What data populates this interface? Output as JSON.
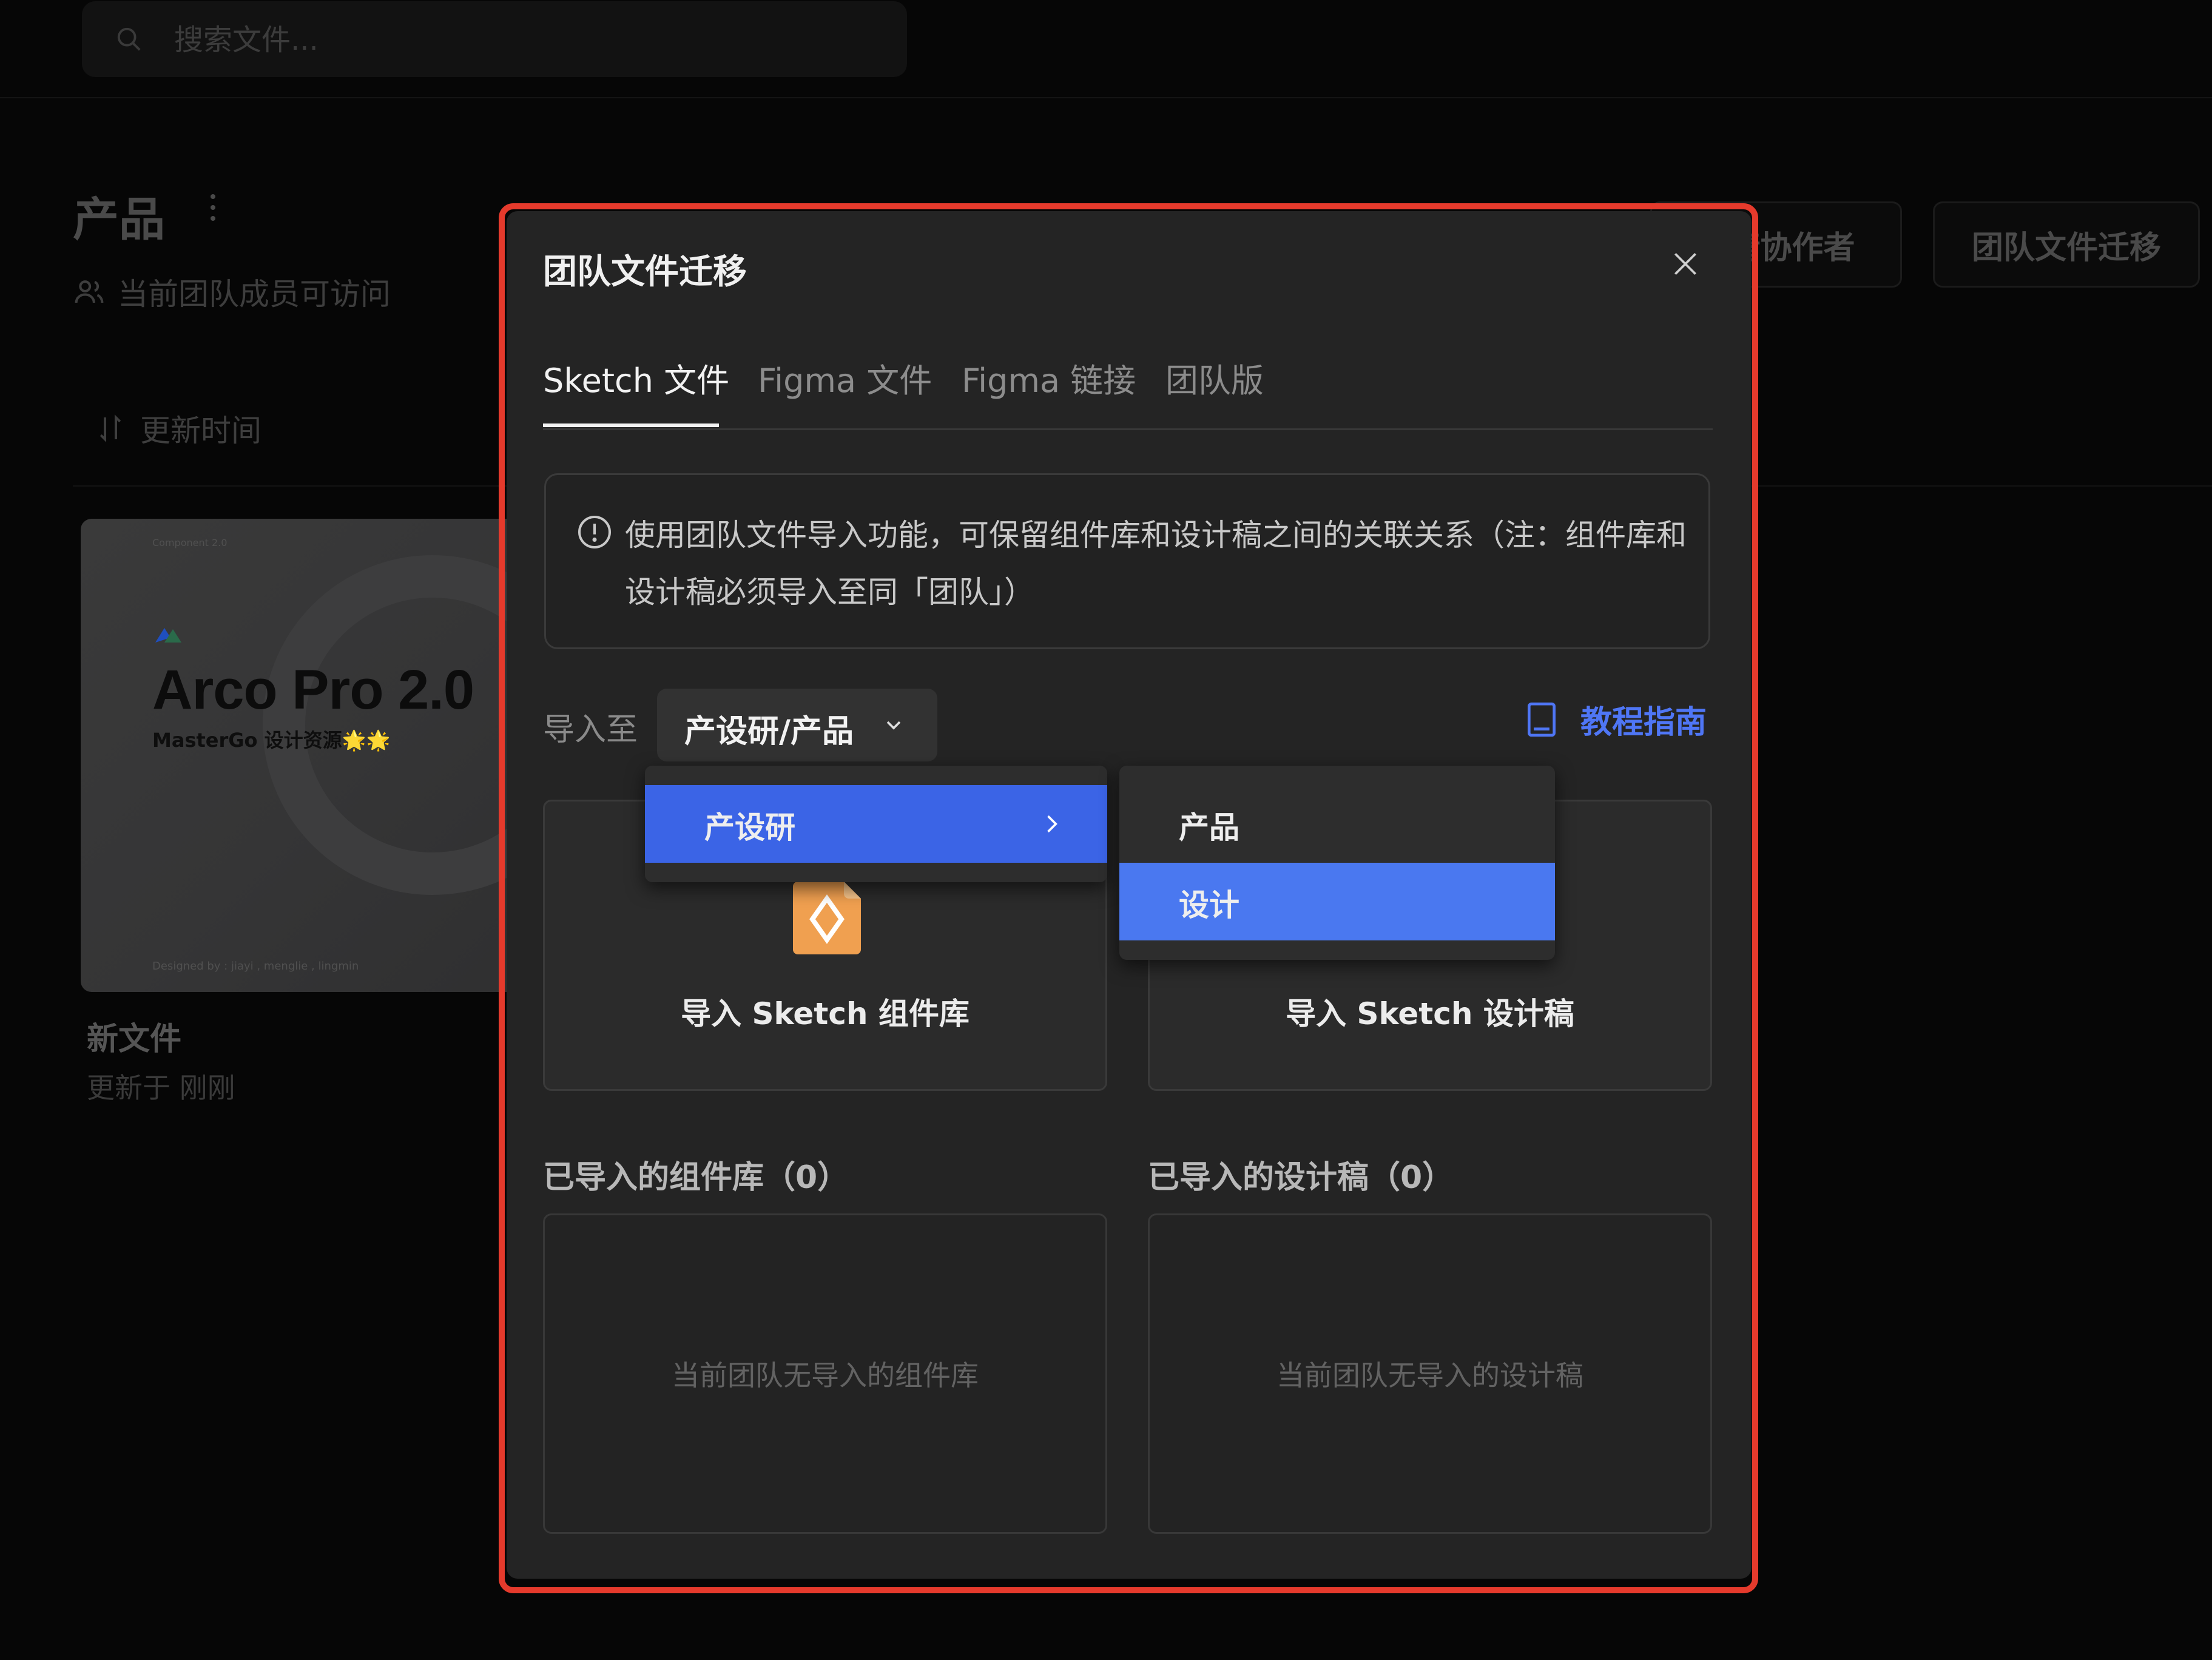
{
  "search": {
    "placeholder": "搜索文件..."
  },
  "project": {
    "title": "产品",
    "access": "当前团队成员可访问",
    "sort_label": "更新时间"
  },
  "header_buttons": {
    "collaborators": "邀请协作者",
    "migrate": "团队文件迁移"
  },
  "file_card": {
    "name": "新文件",
    "updated": "更新于 刚刚",
    "thumbnail": {
      "tag": "Component 2.0",
      "title": "Arco Pro 2.0",
      "subtitle": "MasterGo 设计资源🌟🌟",
      "credits": "Designed by : jiayi , menglie , lingmin"
    }
  },
  "modal": {
    "title": "团队文件迁移",
    "tabs": [
      {
        "label": "Sketch 文件",
        "active": true
      },
      {
        "label": "Figma 文件",
        "active": false
      },
      {
        "label": "Figma 链接",
        "active": false
      },
      {
        "label": "团队版",
        "active": false
      }
    ],
    "notice": "使用团队文件导入功能，可保留组件库和设计稿之间的关联关系（注：组件库和设计稿必须导入至同「团队」）",
    "import_to_label": "导入至",
    "import_to_value": "产设研/产品",
    "guide_label": "教程指南",
    "cards": {
      "library": "导入 Sketch 组件库",
      "design": "导入 Sketch 设计稿"
    },
    "imported_libraries": {
      "title": "已导入的组件库（0）",
      "empty": "当前团队无导入的组件库"
    },
    "imported_designs": {
      "title": "已导入的设计稿（0）",
      "empty": "当前团队无导入的设计稿"
    }
  },
  "cascader": {
    "level1": [
      {
        "label": "产设研",
        "selected": true
      }
    ],
    "level2": [
      {
        "label": "产品",
        "selected": false
      },
      {
        "label": "设计",
        "highlighted": true
      }
    ]
  },
  "colors": {
    "accent": "#3b64e6",
    "link": "#4f76f5",
    "highlight_frame": "#e53a2c",
    "sketch_orange": "#f0a050"
  },
  "icons": [
    "search-icon",
    "more-icon",
    "team-icon",
    "sort-icon",
    "close-icon",
    "info-icon",
    "chevron-down-icon",
    "book-icon",
    "sketch-file-icon",
    "chevron-right-icon"
  ]
}
